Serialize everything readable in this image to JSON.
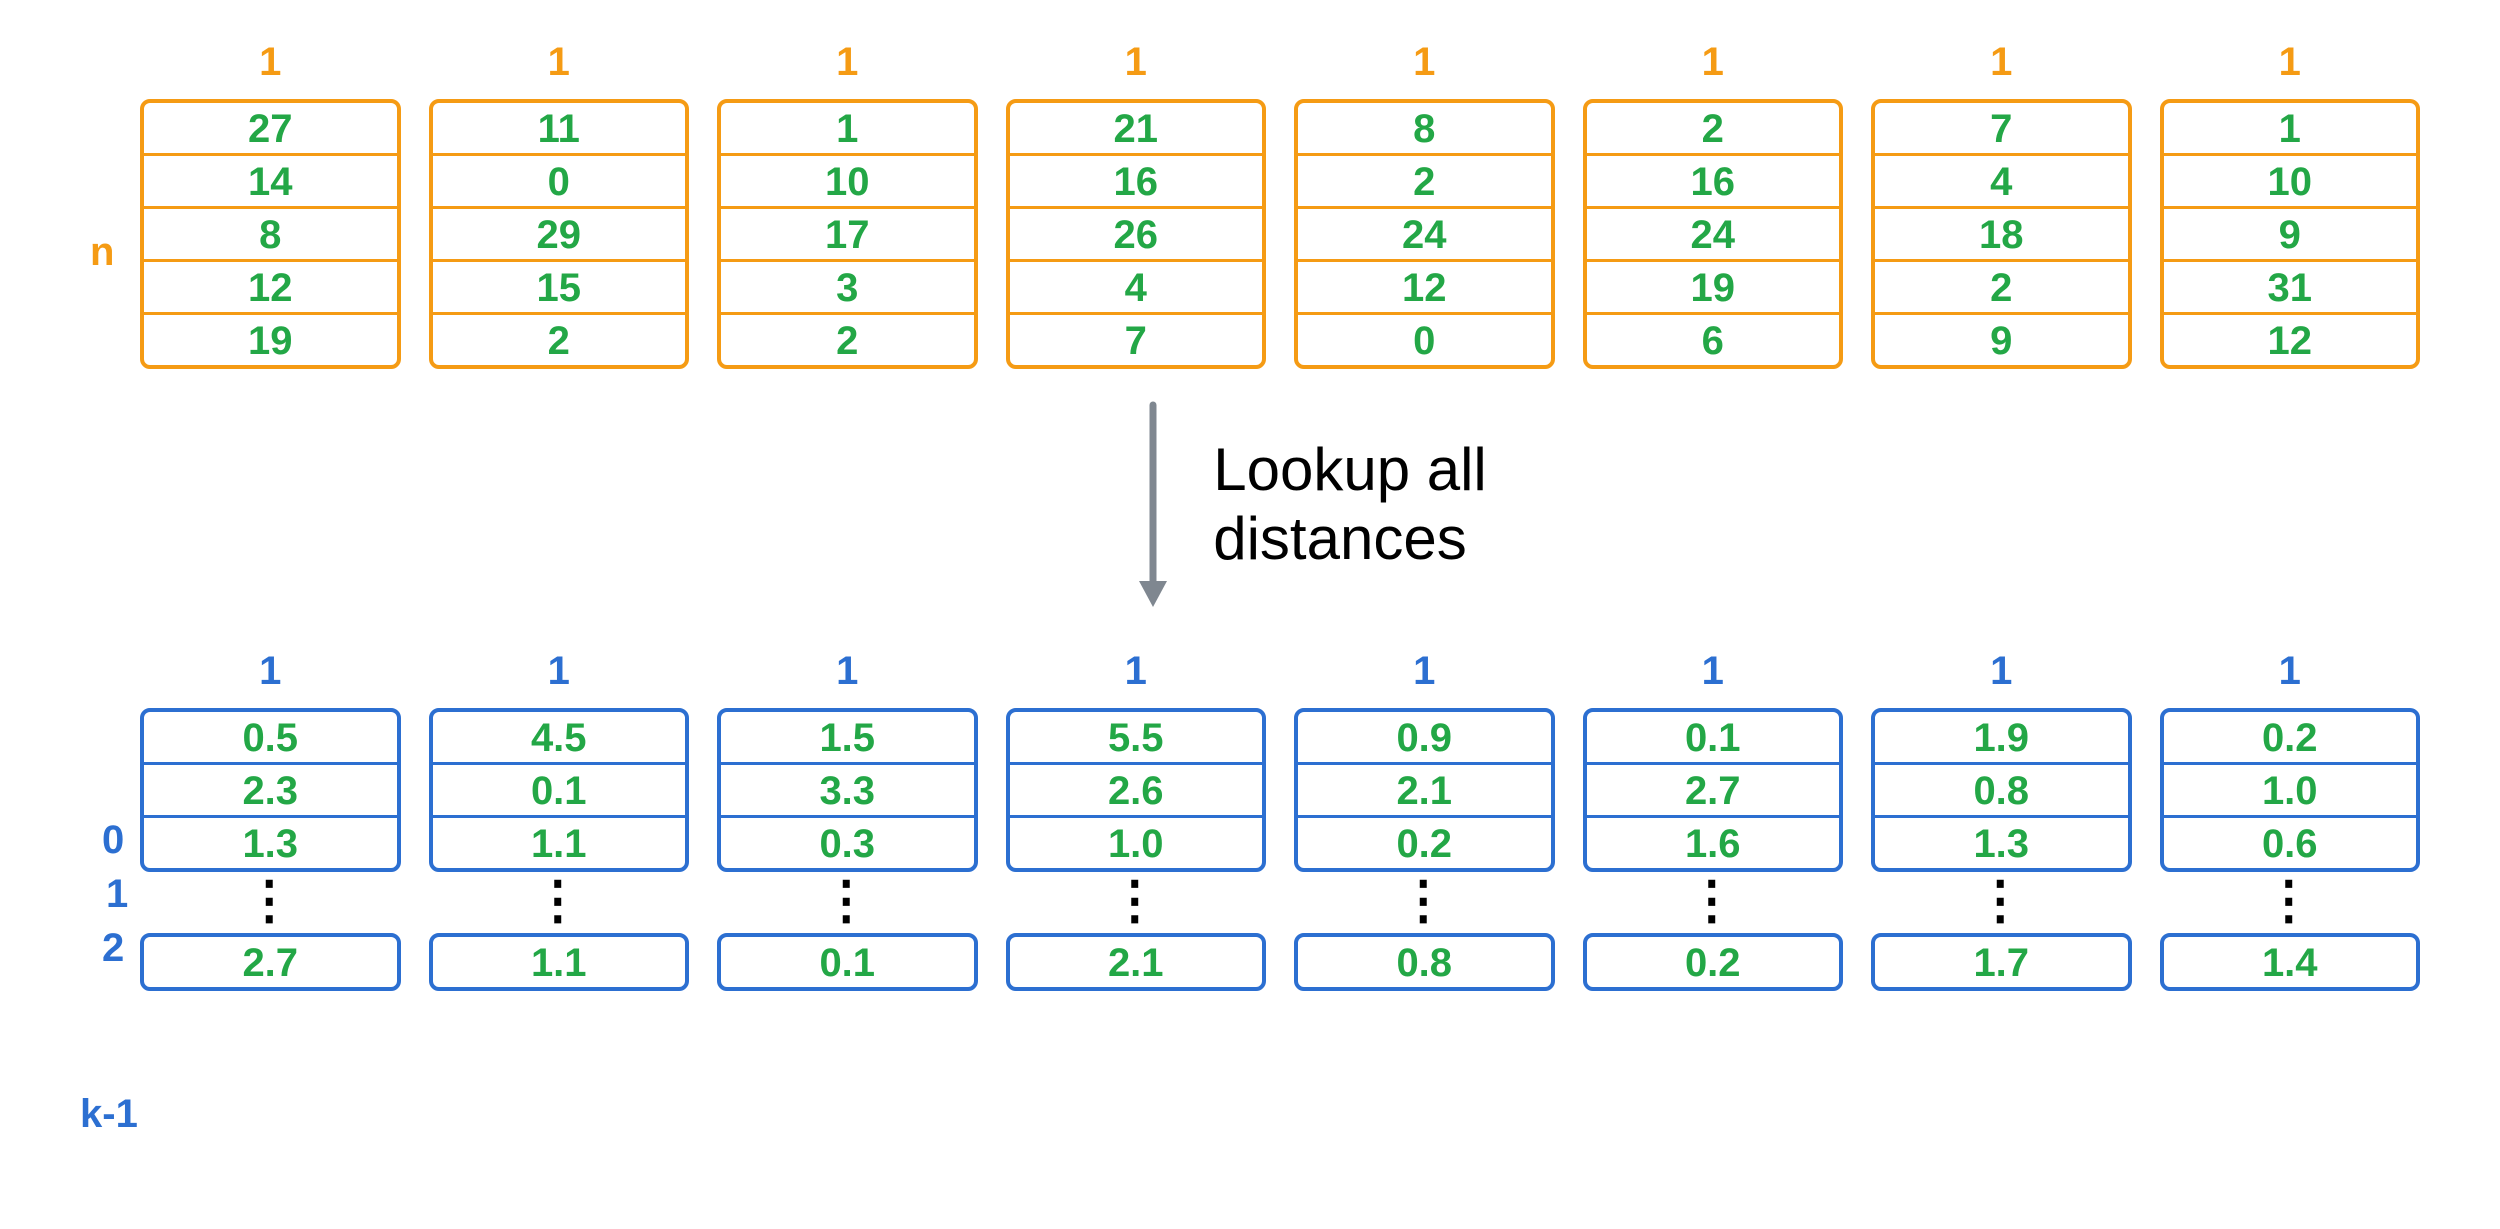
{
  "top": {
    "side_label": "n",
    "column_header": "1",
    "columns": [
      [
        "27",
        "14",
        "8",
        "12",
        "19"
      ],
      [
        "11",
        "0",
        "29",
        "15",
        "2"
      ],
      [
        "1",
        "10",
        "17",
        "3",
        "2"
      ],
      [
        "21",
        "16",
        "26",
        "4",
        "7"
      ],
      [
        "8",
        "2",
        "24",
        "12",
        "0"
      ],
      [
        "2",
        "16",
        "24",
        "19",
        "6"
      ],
      [
        "7",
        "4",
        "18",
        "2",
        "9"
      ],
      [
        "1",
        "10",
        "9",
        "31",
        "12"
      ]
    ]
  },
  "arrow_caption_line1": "Lookup all",
  "arrow_caption_line2": "distances",
  "bottom": {
    "row_labels": [
      "0",
      "1",
      "2"
    ],
    "last_row_label": "k-1",
    "column_header": "1",
    "columns": [
      {
        "top": [
          "0.5",
          "2.3",
          "1.3"
        ],
        "last": "2.7"
      },
      {
        "top": [
          "4.5",
          "0.1",
          "1.1"
        ],
        "last": "1.1"
      },
      {
        "top": [
          "1.5",
          "3.3",
          "0.3"
        ],
        "last": "0.1"
      },
      {
        "top": [
          "5.5",
          "2.6",
          "1.0"
        ],
        "last": "2.1"
      },
      {
        "top": [
          "0.9",
          "2.1",
          "0.2"
        ],
        "last": "0.8"
      },
      {
        "top": [
          "0.1",
          "2.7",
          "1.6"
        ],
        "last": "0.2"
      },
      {
        "top": [
          "1.9",
          "0.8",
          "1.3"
        ],
        "last": "1.7"
      },
      {
        "top": [
          "0.2",
          "1.0",
          "0.6"
        ],
        "last": "1.4"
      }
    ]
  }
}
